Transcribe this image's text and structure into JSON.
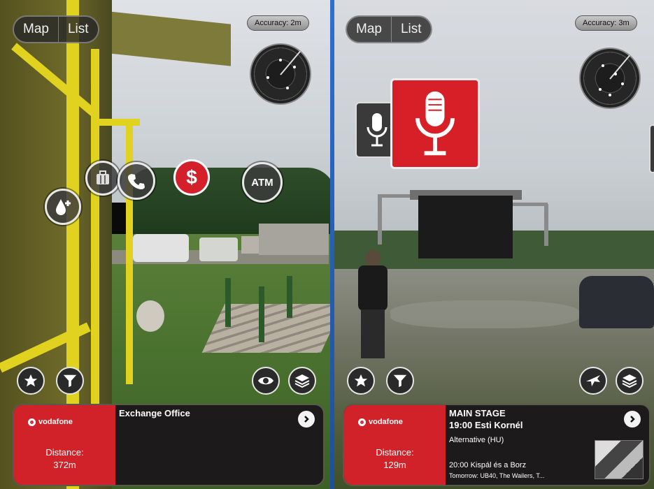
{
  "left_screen": {
    "view_toggle": {
      "map_label": "Map",
      "list_label": "List"
    },
    "accuracy": "Accuracy: 2m",
    "pois": {
      "atm_label": "ATM",
      "exchange_symbol": "$"
    },
    "card": {
      "brand": "vodafone",
      "distance_label": "Distance:",
      "distance_value": "372m",
      "title": "Exchange Office"
    }
  },
  "right_screen": {
    "view_toggle": {
      "map_label": "Map",
      "list_label": "List"
    },
    "accuracy": "Accuracy: 3m",
    "card": {
      "brand": "vodafone",
      "distance_label": "Distance:",
      "distance_value": "129m",
      "title": "MAIN STAGE",
      "event_now": "19:00 Esti Kornél",
      "genre": "Alternative (HU)",
      "event_next": "20:00 Kispál és a Borz",
      "tomorrow": "Tomorrow: UB40, The Wailers, T..."
    }
  },
  "icons": {
    "favorites": "star-icon",
    "filter": "filter-icon",
    "visibility": "eye-icon",
    "layers": "layers-icon",
    "airplane": "airplane-icon",
    "details": "chevron-right-icon",
    "microphone": "microphone-icon",
    "water": "water-drop-plus-icon",
    "luggage": "luggage-icon",
    "phone": "phone-icon"
  },
  "colors": {
    "vodafone_red": "#d1222a",
    "card_bg": "#1c1a1a",
    "divider_blue": "#2f6fd0"
  }
}
